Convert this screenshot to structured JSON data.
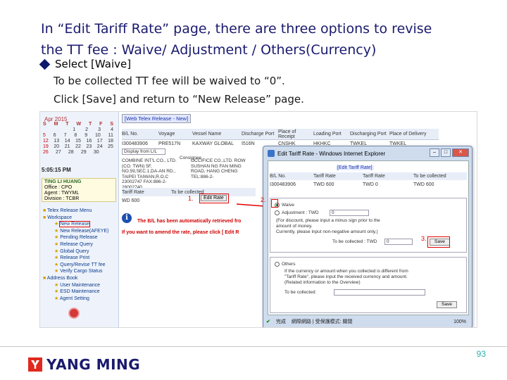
{
  "slide": {
    "title_line1": "In “Edit Tariff Rate” page, there are three options to revise",
    "title_line2": "the TT fee :  Waive/ Adjustment / Others(Currency)",
    "bullet": "Select [Waive]",
    "line1": "To be collected TT fee will be waived to “0”.",
    "line2": "Click [Save] and return to “New Release” page.",
    "page_number": "93",
    "logo_text": "YANG MING"
  },
  "app": {
    "calendar_month": "Apr  2015",
    "calendar_dow": [
      "S",
      "M",
      "T",
      "W",
      "T",
      "F",
      "S"
    ],
    "calendar_rows": [
      [
        "",
        "",
        "",
        "1",
        "2",
        "3",
        "4"
      ],
      [
        "5",
        "6",
        "7",
        "8",
        "9",
        "10",
        "11"
      ],
      [
        "12",
        "13",
        "14",
        "15",
        "16",
        "17",
        "18"
      ],
      [
        "19",
        "20",
        "21",
        "22",
        "23",
        "24",
        "25"
      ],
      [
        "26",
        "27",
        "28",
        "29",
        "30",
        "",
        ""
      ]
    ],
    "clock": "5:05:15 PM",
    "user_name": "TING LI HUANG",
    "office": "Office : CPO",
    "agent": "Agent : TWYML",
    "division": "Division : TCBR",
    "menu_items": [
      {
        "label": "Telex Release Menu",
        "sub": false
      },
      {
        "label": "Workspace",
        "sub": false
      },
      {
        "label": "New Release",
        "sub": true,
        "highlight": true
      },
      {
        "label": "New Release(AFEYE)",
        "sub": true
      },
      {
        "label": "Pending Release",
        "sub": true
      },
      {
        "label": "Release Query",
        "sub": true
      },
      {
        "label": "Global Query",
        "sub": true
      },
      {
        "label": "Release Print",
        "sub": true
      },
      {
        "label": "Query/Revise TT fee",
        "sub": true
      },
      {
        "label": "Verify Cargo Status",
        "sub": true
      },
      {
        "label": "Address Book",
        "sub": false
      },
      {
        "label": "User Maintenance",
        "sub": true
      },
      {
        "label": "ESD Maintenance",
        "sub": true
      },
      {
        "label": "Agent Setting",
        "sub": true
      }
    ],
    "tab_label": "[Web Telex Release  -  New]",
    "grid_headers": [
      "B/L No.",
      "Voyage",
      "Vessel Name",
      "Discharge Port",
      "Place of Receipt",
      "Loading Port",
      "Discharging Port",
      "Place of Delivery"
    ],
    "grid_row": [
      "I300483906",
      "PRE517N",
      "KAXWAY GLOBAL",
      "I516N",
      "CNSHK",
      "HKHKC",
      "TWKEL",
      "TWKEL"
    ],
    "filter_value": "Display from L/L",
    "consignee_label": "Consignee",
    "consignee_text": "COMBINE INT'L CO., LTD. (CO. TWN) 5F, NO.59,SEC.1,DA-AN RD., TAIPEI TAIWAN,R.O.C 23002747  FAX:886-2-28002740",
    "shipper_text": "OCCIFICE CO.,LTD. ROW SUSHAN NG FAN MING ROAD, HANG CHENG TEL:886-2-",
    "tariff_headers": [
      "Tariff Rate",
      "To be collected"
    ],
    "tariff_row": [
      "WD  600",
      ""
    ],
    "edit_rate_button": "Edit Rate",
    "step1": "1.",
    "message1": "The B/L has been automatically retrieved fro",
    "message2": "If you want to amend the rate, please click [ Edit R",
    "info_icon": "i"
  },
  "dialog": {
    "title": "Edit Tariff Rate - Windows Internet Explorer",
    "heading": "[Edit Tariff Rate]",
    "table_headers": [
      "B/L No.",
      "Tariff Rate",
      "Tariff Rate",
      "To be collected"
    ],
    "table_row": [
      "I300483906",
      "TWD  600",
      "TWD  0",
      "TWD  600"
    ],
    "waive_label": "Waive",
    "adjustment_label": "Adjustment : TWD",
    "adjustment_value": "0",
    "discount_note_1": "(For discount, please input a minus sign prior to the",
    "discount_note_2": "amount of money.",
    "discount_note_3": "Currently, please input non-negative amount only.)",
    "to_be_collected_label": "To be collected : TWD",
    "to_be_collected_value": "0",
    "save_label": "Save",
    "others_label": "Others",
    "others_note_1": "If the currency or amount when you collected is different from",
    "others_note_2": "\"Tariff Rate\", please input the received currency and amount.",
    "others_note_3": "(Related information to the Overview)",
    "to_be_collected_label2": "To be collected:",
    "save_label2": "Save",
    "step2": "2.",
    "step3": "3.",
    "status_text": "完成",
    "status_zone": "網際網路 | 受保護模式: 關閉",
    "zoom": "100%"
  }
}
